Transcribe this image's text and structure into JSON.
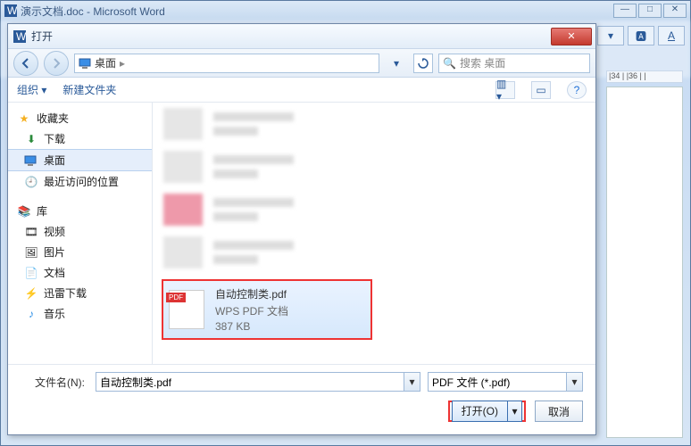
{
  "word": {
    "title": "演示文档.doc - Microsoft Word",
    "ruler": "|34 | |36 | |"
  },
  "dialog": {
    "title": "打开",
    "breadcrumb": {
      "root_icon": "desktop-icon",
      "root": "桌面",
      "sep": "▸"
    },
    "search_placeholder": "搜索 桌面",
    "toolbar": {
      "organize": "组织 ▾",
      "newfolder": "新建文件夹"
    },
    "sidebar": {
      "favorites": {
        "header": "收藏夹",
        "items": [
          {
            "icon": "download-icon",
            "label": "下载"
          },
          {
            "icon": "desktop-icon",
            "label": "桌面",
            "selected": true
          },
          {
            "icon": "recent-icon",
            "label": "最近访问的位置"
          }
        ]
      },
      "libraries": {
        "header": "库",
        "items": [
          {
            "icon": "video-icon",
            "label": "视频"
          },
          {
            "icon": "pictures-icon",
            "label": "图片"
          },
          {
            "icon": "documents-icon",
            "label": "文档"
          },
          {
            "icon": "thunder-icon",
            "label": "迅雷下载"
          },
          {
            "icon": "music-icon",
            "label": "音乐"
          }
        ]
      }
    },
    "selected_file": {
      "name": "自动控制类.pdf",
      "type": "WPS PDF 文档",
      "size": "387 KB"
    },
    "filename_label": "文件名(N):",
    "filename_value": "自动控制类.pdf",
    "filter_value": "PDF 文件 (*.pdf)",
    "open_label": "打开(O)",
    "cancel_label": "取消"
  }
}
